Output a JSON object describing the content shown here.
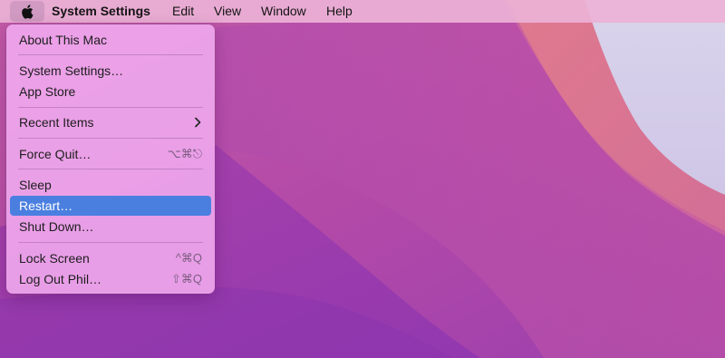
{
  "colors": {
    "wallpaper_base": "#b44aa8",
    "highlight": "#4a7fe0",
    "menu_bg": "#eea6ec"
  },
  "menubar": {
    "apple_icon": "apple-logo-icon",
    "app_name": "System Settings",
    "items": [
      "Edit",
      "View",
      "Window",
      "Help"
    ]
  },
  "apple_menu": {
    "items": [
      {
        "label": "About This Mac",
        "shortcut": ""
      },
      {
        "label": "System Settings…",
        "shortcut": ""
      },
      {
        "label": "App Store",
        "shortcut": ""
      },
      {
        "label": "Recent Items",
        "shortcut": "",
        "submenu_icon": "chevron-right-icon"
      },
      {
        "label": "Force Quit…",
        "shortcut": "⌥⌘⎋"
      },
      {
        "label": "Sleep",
        "shortcut": ""
      },
      {
        "label": "Restart…",
        "shortcut": "",
        "highlighted": true
      },
      {
        "label": "Shut Down…",
        "shortcut": ""
      },
      {
        "label": "Lock Screen",
        "shortcut": "^⌘Q"
      },
      {
        "label": "Log Out Phil…",
        "shortcut": "⇧⌘Q"
      }
    ]
  }
}
